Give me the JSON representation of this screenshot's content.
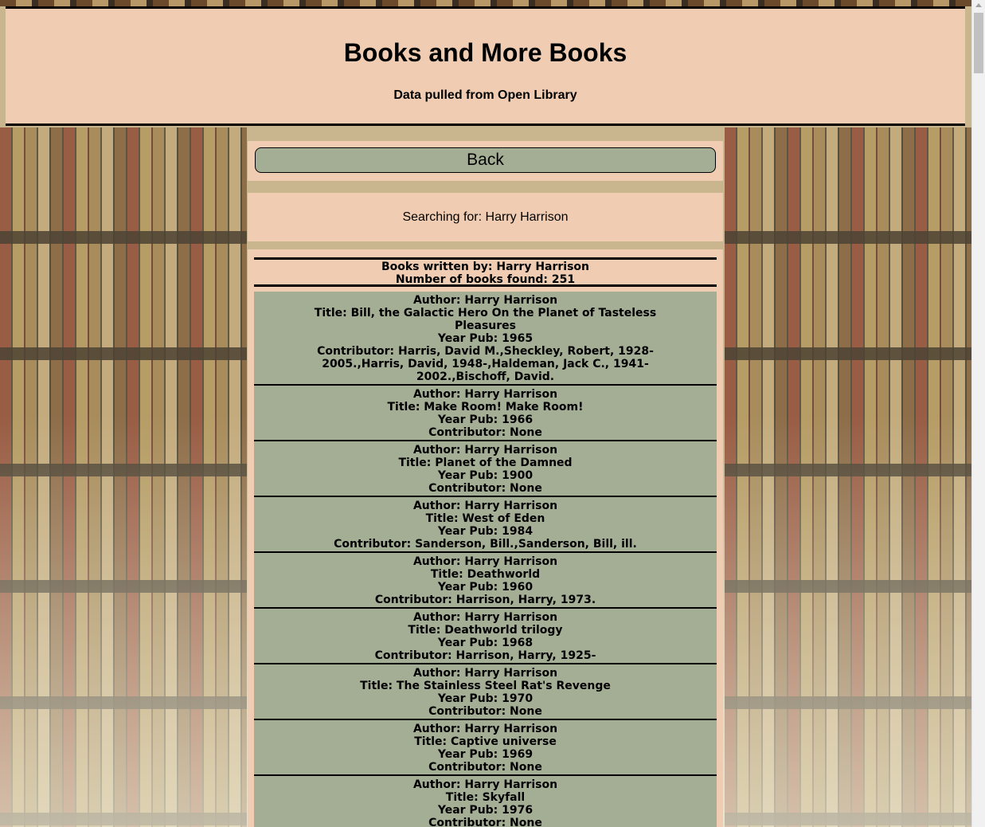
{
  "header": {
    "title": "Books and More Books",
    "subtitle": "Data pulled from Open Library"
  },
  "back_button": {
    "label": "Back"
  },
  "search": {
    "text": "Searching for: Harry Harrison"
  },
  "results": {
    "heading_author": "Books written by: Harry Harrison",
    "heading_count": "Number of books found: 251",
    "books": [
      {
        "author": "Author: Harry Harrison",
        "title": "Title: Bill, the Galactic Hero On the Planet of Tasteless Pleasures",
        "year": "Year Pub: 1965",
        "contributor": "Contributor: Harris, David M.,Sheckley, Robert, 1928-2005.,Harris, David, 1948-,Haldeman, Jack C., 1941-2002.,Bischoff, David."
      },
      {
        "author": "Author: Harry Harrison",
        "title": "Title: Make Room! Make Room!",
        "year": "Year Pub: 1966",
        "contributor": "Contributor: None"
      },
      {
        "author": "Author: Harry Harrison",
        "title": "Title: Planet of the Damned",
        "year": "Year Pub: 1900",
        "contributor": "Contributor: None"
      },
      {
        "author": "Author: Harry Harrison",
        "title": "Title: West of Eden",
        "year": "Year Pub: 1984",
        "contributor": "Contributor: Sanderson, Bill.,Sanderson, Bill, ill."
      },
      {
        "author": "Author: Harry Harrison",
        "title": "Title: Deathworld",
        "year": "Year Pub: 1960",
        "contributor": "Contributor: Harrison, Harry, 1973."
      },
      {
        "author": "Author: Harry Harrison",
        "title": "Title: Deathworld trilogy",
        "year": "Year Pub: 1968",
        "contributor": "Contributor: Harrison, Harry, 1925-"
      },
      {
        "author": "Author: Harry Harrison",
        "title": "Title: The Stainless Steel Rat's Revenge",
        "year": "Year Pub: 1970",
        "contributor": "Contributor: None"
      },
      {
        "author": "Author: Harry Harrison",
        "title": "Title: Captive universe",
        "year": "Year Pub: 1969",
        "contributor": "Contributor: None"
      },
      {
        "author": "Author: Harry Harrison",
        "title": "Title: Skyfall",
        "year": "Year Pub: 1976",
        "contributor": "Contributor: None"
      }
    ]
  },
  "colors": {
    "panel": "#f0cdb2",
    "card": "#a3ae95",
    "border": "#000000"
  }
}
